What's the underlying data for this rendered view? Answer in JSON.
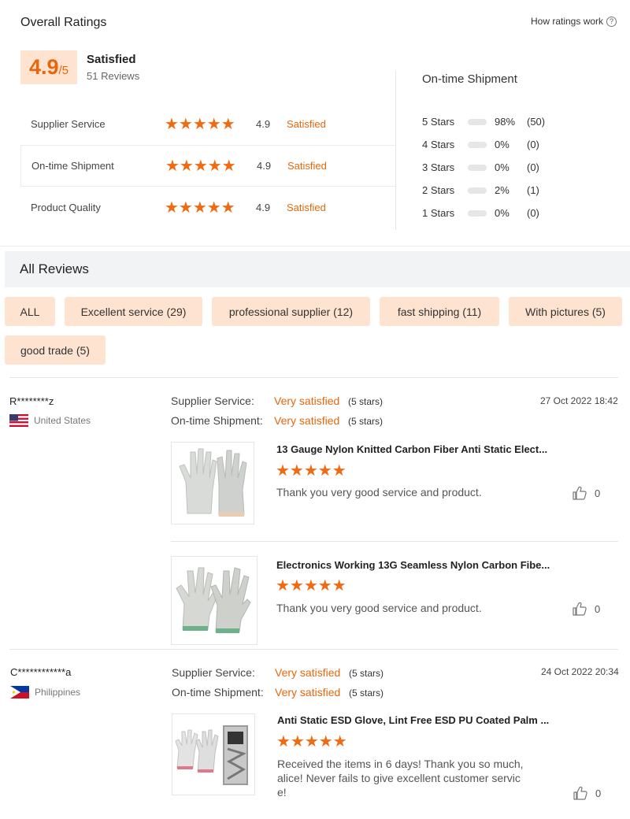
{
  "overall": {
    "title": "Overall Ratings",
    "how_link": "How ratings work",
    "score": "4.9",
    "score_max": "/5",
    "satisfaction": "Satisfied",
    "review_count": "51 Reviews",
    "rows": [
      {
        "label": "Supplier Service",
        "stars": "★★★★★",
        "score": "4.9",
        "status": "Satisfied"
      },
      {
        "label": "On-time Shipment",
        "stars": "★★★★★",
        "score": "4.9",
        "status": "Satisfied"
      },
      {
        "label": "Product Quality",
        "stars": "★★★★★",
        "score": "4.9",
        "status": "Satisfied"
      }
    ]
  },
  "shipment": {
    "title": "On-time Shipment",
    "distribution": [
      {
        "stars": "5  Stars",
        "percent": "98%",
        "count": "(50)",
        "fraction": 0.98
      },
      {
        "stars": "4  Stars",
        "percent": "0%",
        "count": "(0)",
        "fraction": 0
      },
      {
        "stars": "3  Stars",
        "percent": "0%",
        "count": "(0)",
        "fraction": 0
      },
      {
        "stars": "2  Stars",
        "percent": "2%",
        "count": "(1)",
        "fraction": 0.02
      },
      {
        "stars": "1  Stars",
        "percent": "0%",
        "count": "(0)",
        "fraction": 0
      }
    ]
  },
  "reviews_section": {
    "title": "All Reviews",
    "tags": [
      "ALL",
      "Excellent service (29)",
      "professional supplier (12)",
      "fast shipping (11)",
      "With pictures (5)",
      "good trade (5)"
    ]
  },
  "reviews": [
    {
      "user": "R********z",
      "country": "United States",
      "flag": "us-flag-icon",
      "date": "27 Oct 2022 18:42",
      "supplier_label": "Supplier Service:",
      "supplier_value": "Very satisfied",
      "supplier_stars": "(5 stars)",
      "shipment_label": "On-time Shipment:",
      "shipment_value": "Very satisfied",
      "shipment_stars": "(5 stars)",
      "products": [
        {
          "title": "13 Gauge Nylon Knitted Carbon Fiber Anti Static Elect...",
          "stars": "★★★★★",
          "text": "Thank you very good service and product.",
          "likes": "0"
        },
        {
          "title": "Electronics Working 13G Seamless Nylon Carbon Fibe...",
          "stars": "★★★★★",
          "text": "Thank you very good service and product.",
          "likes": "0"
        }
      ]
    },
    {
      "user": "C************a",
      "country": "Philippines",
      "flag": "ph-flag-icon",
      "date": "24 Oct 2022 20:34",
      "supplier_label": "Supplier Service:",
      "supplier_value": "Very satisfied",
      "supplier_stars": "(5 stars)",
      "shipment_label": "On-time Shipment:",
      "shipment_value": "Very satisfied",
      "shipment_stars": "(5 stars)",
      "products": [
        {
          "title": "Anti Static ESD Glove, Lint Free ESD PU Coated Palm ...",
          "stars": "★★★★★",
          "text": "Received the items in 6 days! Thank you so much, alice! Never fails to give excellent customer servic e!",
          "likes": "0"
        }
      ]
    }
  ],
  "colors": {
    "accent": "#e8660b",
    "star": "#f26a10",
    "tag_bg": "#fde3d0"
  }
}
